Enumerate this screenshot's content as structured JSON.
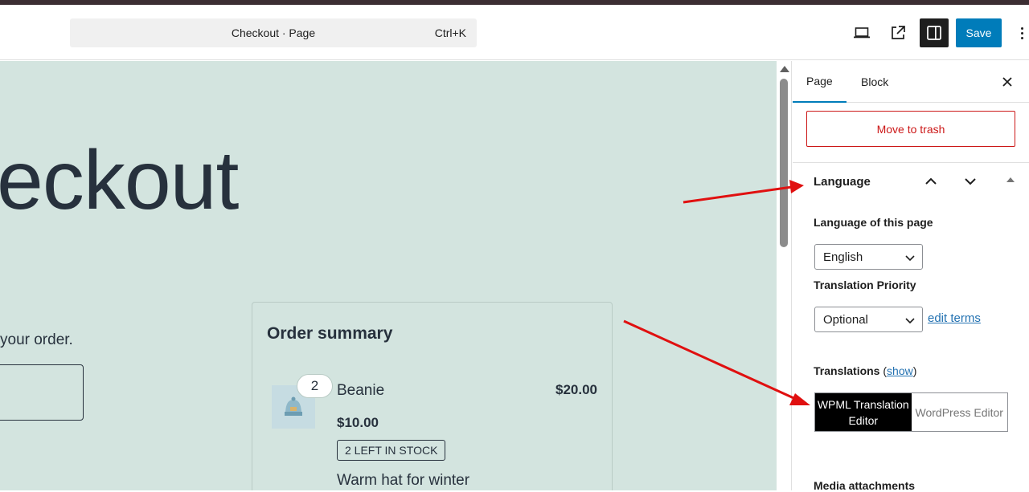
{
  "header": {
    "command_label": "Checkout · Page",
    "shortcut": "Ctrl+K",
    "save_label": "Save"
  },
  "canvas": {
    "title_fragment": "eckout",
    "order_text": "your order.",
    "order_summary": {
      "heading": "Order summary",
      "quantity": "2",
      "product_name": "Beanie",
      "line_total": "$20.00",
      "unit_price": "$10.00",
      "stock_badge": "2 LEFT IN STOCK",
      "description": "Warm hat for winter"
    }
  },
  "sidebar": {
    "tabs": [
      {
        "label": "Page"
      },
      {
        "label": "Block"
      }
    ],
    "move_to_trash": "Move to trash",
    "language_panel": {
      "title": "Language",
      "language_label": "Language of this page",
      "language_value": "English",
      "priority_label": "Translation Priority",
      "priority_value": "Optional",
      "edit_terms": "edit terms",
      "translations_label": "Translations",
      "show_link": "show",
      "editor_options": [
        {
          "label": "WPML Translation Editor",
          "selected": true
        },
        {
          "label": "WordPress Editor",
          "selected": false
        }
      ]
    },
    "media_label": "Media attachments"
  },
  "colors": {
    "accent": "#007cba",
    "destructive": "#cc1818",
    "canvas_bg": "#d3e4df",
    "annotation_arrow": "#e01010"
  },
  "icons": [
    "laptop-icon",
    "external-link-icon",
    "sidebar-toggle-icon",
    "more-vertical-icon",
    "close-icon",
    "chevron-up-icon",
    "chevron-down-icon"
  ]
}
